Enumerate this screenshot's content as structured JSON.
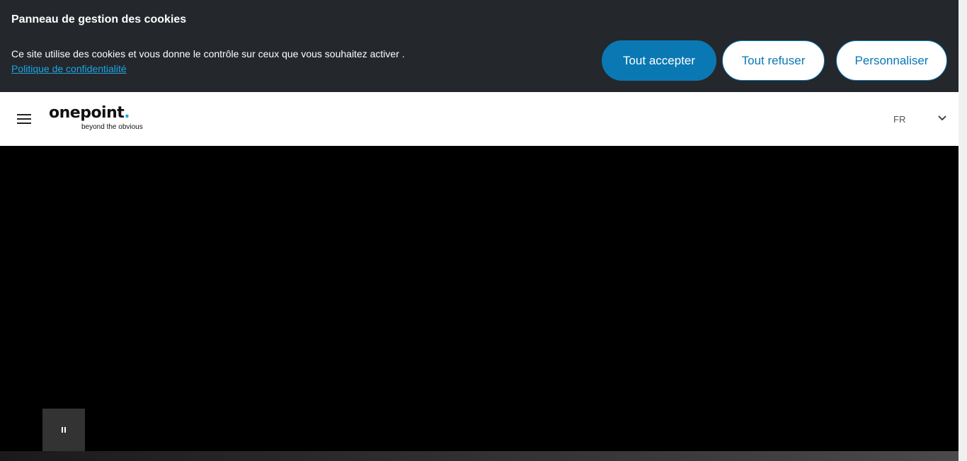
{
  "cookie_banner": {
    "title": "Panneau de gestion des cookies",
    "text": "Ce site utilise des cookies et vous donne le contrôle sur ceux que vous souhaitez activer .",
    "privacy_link": "Politique de confidentialité",
    "accept_label": "Tout accepter",
    "refuse_label": "Tout refuser",
    "customize_label": "Personnaliser"
  },
  "header": {
    "logo_main": "onepoint",
    "logo_dot": ".",
    "logo_tagline": "beyond the obvious",
    "language": "FR"
  },
  "icons": {
    "menu": "hamburger-menu-icon",
    "language_dropdown": "chevron-down-icon",
    "video_control": "pause-icon"
  },
  "colors": {
    "banner_bg": "#24272c",
    "accent": "#0a78b3",
    "link": "#1aa6e6",
    "header_bg": "#ffffff",
    "video_bg": "#000000"
  }
}
